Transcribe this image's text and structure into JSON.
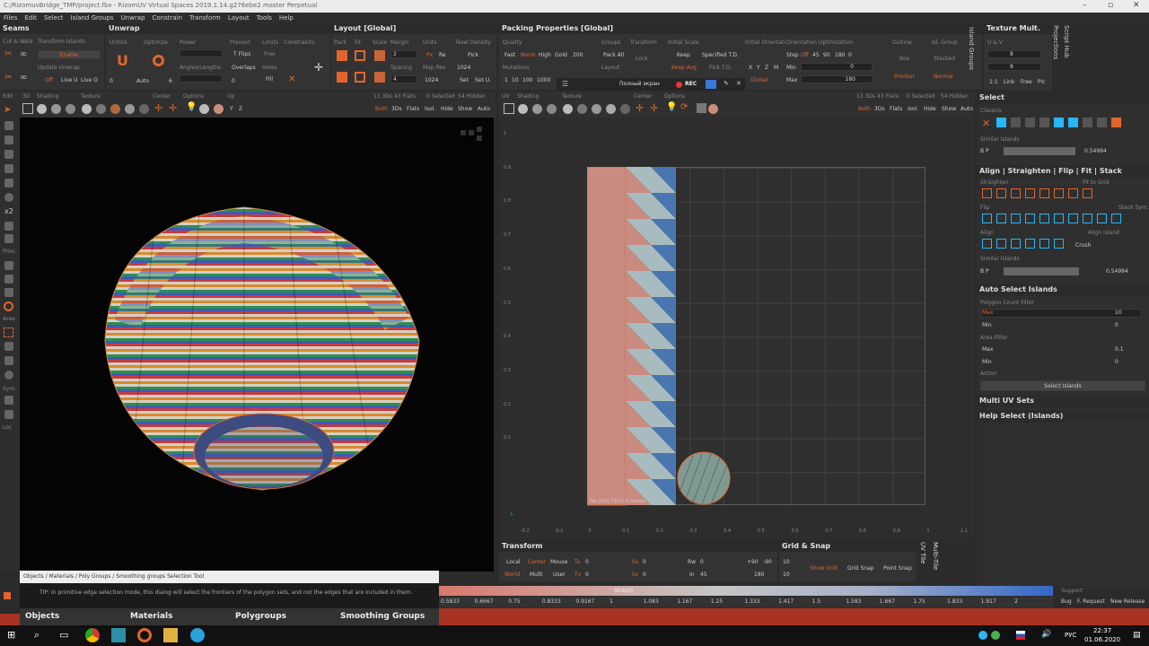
{
  "window": {
    "title": "C:/RizomuvBridge_TMP/project.fbx - RizomUV  Virtual Spaces 2019.1.14.g276ebe2.master Perpetual"
  },
  "menu": [
    "Files",
    "Edit",
    "Select",
    "Island Groups",
    "Unwrap",
    "Constrain",
    "Transform",
    "Layout",
    "Tools",
    "Help"
  ],
  "panels": {
    "seams": {
      "title": "Seams",
      "cut_weld": "Cut & Weld",
      "transform_islands": "Transform Islands",
      "enable": "Enable",
      "update_unwrap": "Update Unwrap",
      "off": "Off",
      "live_u": "Live U",
      "live_o": "Live O"
    },
    "unwrap": {
      "title": "Unwrap",
      "unfold": "Unfold",
      "optimize": "Optimize",
      "power": "Power",
      "prevent": "Prevent",
      "limits": "Limits",
      "constraints": "Constraints",
      "t_flips": "T Flips",
      "free": "Free",
      "overlaps": "Overlaps",
      "holes": "Holes",
      "angles": "Angles/Lengths",
      "fill": "Fill",
      "auto": "Auto",
      "zero1": "0",
      "zero2": "0",
      "six": "6"
    },
    "layout": {
      "title": "Layout [Global]",
      "pack": "Pack",
      "fit": "Fit",
      "scale": "Scale",
      "margin": "Margin",
      "units": "Units",
      "texel": "Texel Density",
      "margin_val": "2",
      "spacing": "Spacing",
      "spacing_val": "4",
      "px": "Px",
      "re": "Re",
      "pick": "Pick",
      "map_res": "Map Res",
      "map_res_val": "1024",
      "res_val": "1024",
      "set": "Set",
      "set_u": "Set U."
    },
    "packing": {
      "title": "Packing Properties [Global]",
      "quality": "Quality",
      "fast": "Fast",
      "norm": "Norm",
      "high": "High",
      "gold": "Gold",
      "q_val": "200",
      "groups": "Groups",
      "pack_all": "Pack All",
      "transform": "Transform",
      "initial_scale": "Initial Scale",
      "keep": "Keep",
      "specified": "Specified T.D.",
      "initial_orient": "Initial Orientati",
      "orient_opt": "Orientation Optimization",
      "step": "Step",
      "off": "Off",
      "a45": "45",
      "a90": "90",
      "a180": "180",
      "a0": "0",
      "min": "Min",
      "max": "Max",
      "min_val": "0",
      "max_val": "180",
      "outline": "Outline",
      "isl_group": "Isl. Group",
      "box": "Box",
      "stacked": "Stacked",
      "frontier": "Frontier",
      "normal": "Normal",
      "mutations": "Mutations",
      "m1": "1",
      "m10": "10",
      "m100": "100",
      "m1000": "1000",
      "lock": "Lock",
      "keep_avg": "Keep Avg",
      "pick_td": "Pick T.D.",
      "layout": "Layout",
      "global": "Global",
      "x": "X",
      "y": "Y",
      "z": "Z",
      "m": "M"
    },
    "texture_mult": {
      "title": "Texture Mult.",
      "uv": "U & V",
      "u_val": "8",
      "v_val": "8",
      "one": "1:1",
      "link": "Link",
      "free": "Free",
      "pic": "Pic"
    },
    "side": {
      "island_groups": "Island Groups",
      "projections": "Projections",
      "script_hub": "Script Hub",
      "uv_tile": "UV Tile",
      "multi_tile": "Multi-Tile"
    }
  },
  "screen_rec": {
    "label": "Полный экран",
    "rec": "REC"
  },
  "view3d": {
    "edit": "Edit",
    "d3": "3D",
    "shading": "Shading",
    "texture": "Texture",
    "center": "Center",
    "options": "Options",
    "up": "Up",
    "y": "Y",
    "z": "Z",
    "stats": "13 3Ds 43 Flats",
    "selected": "0 Selected",
    "hidden": "54 Hidden",
    "both": "Both",
    "d3s": "3Ds",
    "flats": "Flats",
    "isol": "Isol.",
    "hide": "Hide",
    "show": "Show",
    "auto": "Auto",
    "x2": "x2",
    "prim": "Prim.",
    "area": "Area",
    "sym": "Sym.",
    "loc": "Loc"
  },
  "viewuv": {
    "uv": "UV",
    "shading": "Shading",
    "texture": "Texture",
    "center": "Center",
    "options": "Options",
    "stats": "13 3Ds 43 Flats",
    "selected": "0 Selected",
    "hidden": "54 Hidden",
    "tile_label": "Tile 1001  715%   X  islands",
    "v_ticks": [
      "1",
      "0.9",
      "0.8",
      "0.7",
      "0.6",
      "0.5",
      "0.4",
      "0.3",
      "0.2",
      "0.1"
    ],
    "u_ticks": [
      "-0.2",
      "-0.1",
      "0",
      "0.1",
      "0.2",
      "0.3",
      "0.4",
      "0.5",
      "0.6",
      "0.7",
      "0.8",
      "0.9",
      "1",
      "1.1"
    ]
  },
  "select": {
    "title": "Select",
    "classics": "Classics",
    "similar": "Similar Islands",
    "bp": "B  P",
    "sim_val": "0.54994"
  },
  "align": {
    "title": "Align | Straighten | Flip | Fit | Stack",
    "straighten": "Straighten",
    "fit_grid": "Fit to Grid",
    "flip": "Flip",
    "stack_sym": "Stack Sym.",
    "align": "Align",
    "align_island": "Align Island",
    "crush": "Crush",
    "l": "L",
    "t": "T",
    "similar": "Similar Islands",
    "sim_val": "0.54994"
  },
  "auto_select": {
    "title": "Auto Select Islands",
    "poly_filter": "Polygon Count Filter",
    "max": "Max",
    "min": "Min",
    "max_val": "10",
    "min_val": "0",
    "area_filter": "Area Filter",
    "amax": "Max",
    "amin": "Min",
    "amax_val": "0.1",
    "amin_val": "0",
    "action": "Action",
    "select_btn": "Select Islands"
  },
  "multi_uv": "Multi UV Sets",
  "help_select": "Help Select (Islands)",
  "transform": {
    "title": "Transform",
    "local": "Local",
    "center": "Center",
    "mouse": "Mouse",
    "world": "World",
    "multi": "Multi",
    "user": "User",
    "tu": "Tu",
    "tv": "Tv",
    "su": "Su",
    "sv": "Sv",
    "rw": "Rw",
    "in": "In",
    "tu_val": "0",
    "tv_val": "0",
    "su_val": "0",
    "sv_val": "0",
    "rw_val": "0",
    "in_val": "45",
    "p90": "+90",
    "m90": "-90",
    "r180": "180"
  },
  "grid_snap": {
    "title": "Grid & Snap",
    "v1": "10",
    "v2": "10",
    "show_grid": "Show Grid",
    "grid_snap": "Grid Snap",
    "point_snap": "Point Snap"
  },
  "help_bar": "Objects / Materials / Poly Groups / Smoothing groups Selection Tool",
  "tip": "TIP: In primitive edge selection mode, this dialog will select the frontiers of the polygon sets, and not the edges that are included in them.",
  "tabs": [
    "Objects",
    "Materials",
    "Polygroups",
    "Smoothing Groups"
  ],
  "stretch": {
    "label": "Stretch",
    "ticks": [
      "0.5833",
      "0.6667",
      "0.75",
      "0.8333",
      "0.9167",
      "1",
      "1.083",
      "1.167",
      "1.25",
      "1.333",
      "1.417",
      "1.5",
      "1.583",
      "1.667",
      "1.75",
      "1.833",
      "1.917",
      "2"
    ]
  },
  "support": {
    "label": "Support",
    "bug": "Bug",
    "request": "F. Request",
    "release": "New Release"
  },
  "taskbar": {
    "lang": "РУС",
    "time": "22:37",
    "date": "01.06.2020"
  },
  "colors": {
    "accent": "#e2662b",
    "uv_red": "#c98b80",
    "uv_blue": "#4a76b0"
  }
}
